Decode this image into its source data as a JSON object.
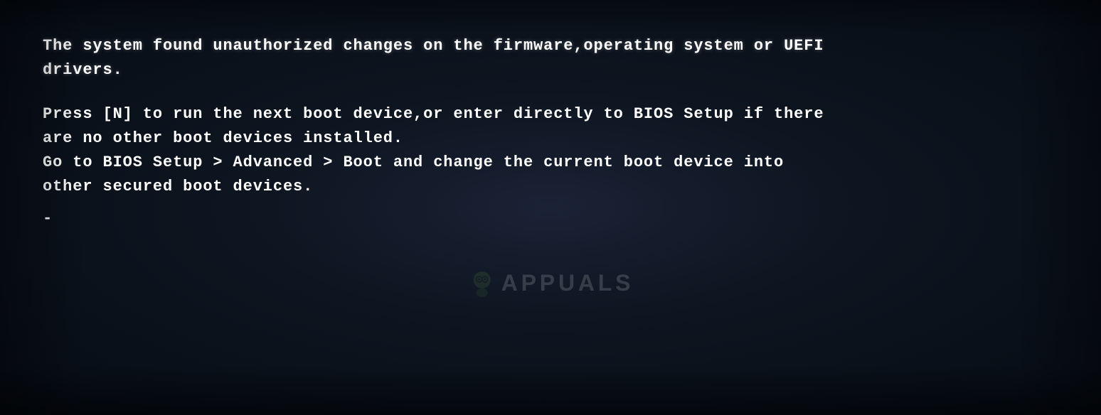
{
  "screen": {
    "background_color": "#0d1520",
    "text_color": "#ffffff"
  },
  "content": {
    "error_line1": "The system found unauthorized changes on the firmware,operating system or UEFI",
    "error_line2": "drivers.",
    "blank_line": "",
    "instruction_line1": "Press [N] to run the next boot device,or enter directly to BIOS Setup if there",
    "instruction_line2": "are no other boot devices installed.",
    "instruction_line3": "Go to BIOS Setup > Advanced > Boot and change the current boot device into",
    "instruction_line4": "other secured boot devices.",
    "cursor": "-",
    "watermark": "APPUALS"
  }
}
